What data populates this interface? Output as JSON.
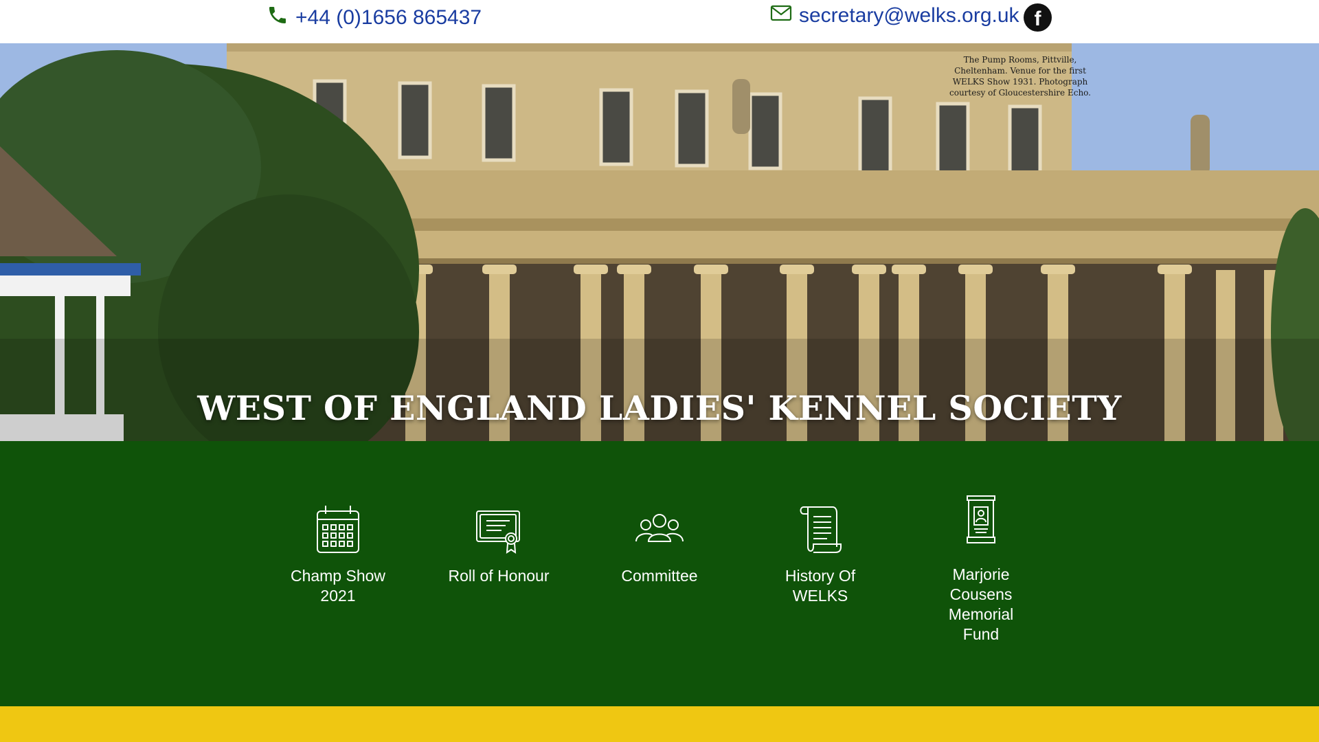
{
  "topbar": {
    "phone": "+44 (0)1656 865437",
    "email": "secretary@welks.org.uk",
    "facebook_icon": "facebook-icon"
  },
  "hero": {
    "caption": "The Pump Rooms, Pittville, Cheltenham.  Venue for the first WELKS Show 1931. Photograph courtesy of Gloucestershire Echo.",
    "title": "WEST OF ENGLAND LADIES' KENNEL SOCIETY"
  },
  "nav": {
    "items": [
      {
        "label": "Champ Show 2021",
        "icon": "calendar-icon"
      },
      {
        "label": "Roll of Honour",
        "icon": "certificate-icon"
      },
      {
        "label": "Committee",
        "icon": "people-group-icon"
      },
      {
        "label": "History Of WELKS",
        "icon": "scroll-icon"
      },
      {
        "label": "Marjorie Cousens Memorial Fund",
        "icon": "memorial-scroll-icon"
      }
    ]
  },
  "colors": {
    "link": "#1a3da1",
    "nav_green": "#0f5309",
    "accent_yellow": "#efc712",
    "icon_green": "#1e6b14"
  }
}
